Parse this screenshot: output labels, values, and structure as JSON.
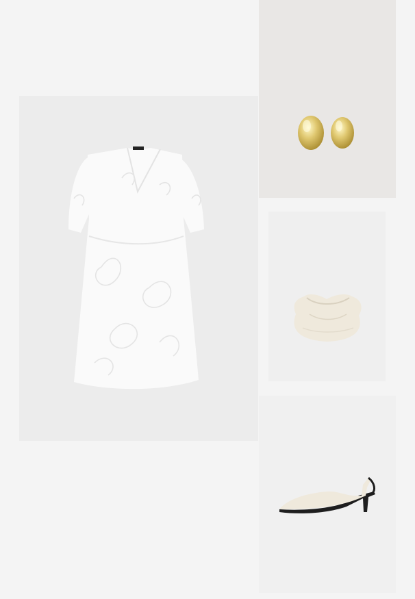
{
  "colors": {
    "page_bg": "#f4f4f4",
    "tile_bg_dress": "#ececec",
    "tile_bg_earrings": "#e9e7e5",
    "tile_bg_bag": "#efefef",
    "tile_bg_shoes": "#f0f0f0",
    "dress": "#fafafa",
    "gold": "#d9c060",
    "cream": "#efe9dc",
    "shoe_black": "#1e1e1e"
  },
  "collage": {
    "items": [
      {
        "id": "dress",
        "icon": "white-lace-dress-image"
      },
      {
        "id": "earrings",
        "icon": "gold-stud-earrings-image"
      },
      {
        "id": "bag",
        "icon": "cream-pouch-clutch-bag-image"
      },
      {
        "id": "shoes",
        "icon": "cream-slingback-kitten-heel-image"
      }
    ]
  }
}
